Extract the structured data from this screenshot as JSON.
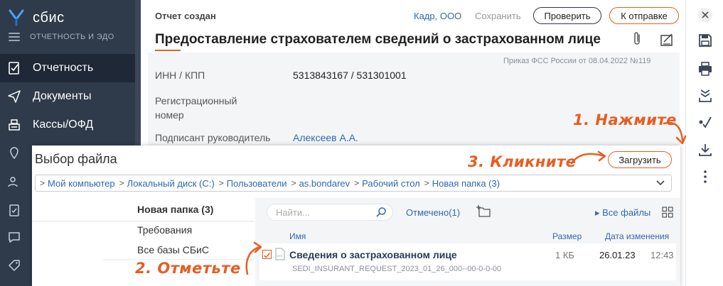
{
  "sidebar": {
    "logo": "сбис",
    "subtitle": "ОТЧЕТНОСТЬ И ЭДО",
    "items": [
      {
        "label": "Отчетность",
        "icon": "report-icon"
      },
      {
        "label": "Документы",
        "icon": "send-icon"
      },
      {
        "label": "Кассы/ОФД",
        "icon": "cash-register-icon"
      }
    ],
    "collapsed_icons": [
      "map-pin-icon",
      "people-icon",
      "clipboard-icon",
      "chat-icon",
      "tag-icon"
    ]
  },
  "header": {
    "status": "Отчет создан",
    "company": "Кадр, ООО",
    "save_label": "Сохранить",
    "check_label": "Проверить",
    "send_label": "К отправке"
  },
  "document": {
    "title": "Предоставление страхователем сведений о застрахованном лице",
    "order": "Приказ ФСС России от 08.04.2022 №119",
    "fields": [
      {
        "label": "ИНН / КПП",
        "value": "5313843167 / 531301001"
      },
      {
        "label": "Регистрационный номер",
        "value": ""
      },
      {
        "label": "Подписант руководитель",
        "value": "Алексеев А.А."
      }
    ],
    "reg_label_line1": "Регистрационный",
    "reg_label_line2": "номер"
  },
  "dialog": {
    "title": "Выбор файла",
    "upload_label": "Загрузить",
    "path": [
      "Мой компьютер",
      "Локальный диск (C:)",
      "Пользователи",
      "as.bondarev",
      "Рабочий стол",
      "Новая папка (3)"
    ],
    "folders": [
      "Новая папка (3)",
      "Требования",
      "Все базы СБиС"
    ],
    "search_placeholder": "Найти...",
    "marked": "Отмечено(1)",
    "all_files": "Все файлы",
    "columns": {
      "name": "Имя",
      "size": "Размер",
      "date": "Дата изменения"
    },
    "file": {
      "name": "Сведения о застрахованном лице",
      "filename": "SEDI_INSURANT_REQUEST_2023_01_26_000--00-0-0-00",
      "size": "1 КБ",
      "date": "26.01.23",
      "time": "12:43",
      "checked": true
    }
  },
  "annotations": {
    "step1": "1. Нажмите",
    "step2": "2. Отметьте",
    "step3": "3. Кликните"
  },
  "toolbar": [
    "close-icon",
    "save-icon",
    "print-icon",
    "download-tray-icon",
    "check-signature-icon",
    "download-icon",
    "more-icon"
  ],
  "colors": {
    "accent": "#e65e22",
    "link": "#2f68b0",
    "sidebar": "#2f3a4b"
  }
}
